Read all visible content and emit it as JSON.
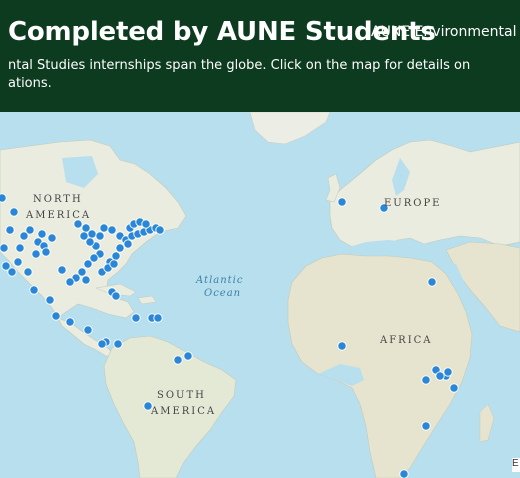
{
  "header": {
    "title": "Completed by AUNE Students",
    "subtitle": "AUNE Environmental St",
    "description_line1": "ntal Studies internships span the globe. Click on the map for details on",
    "description_line2": "ations."
  },
  "map": {
    "labels": {
      "north1": "NORTH",
      "north2": "AMERICA",
      "europe": "EUROPE",
      "africa": "AFRICA",
      "south1": "SOUTH",
      "south2": "AMERICA",
      "ocean1": "Atlantic",
      "ocean2": "Ocean"
    },
    "credit": "E",
    "colors": {
      "header_bg": "#0c3b1f",
      "ocean": "#b8dfee",
      "land": "#e9ecdf",
      "marker": "#2a86d6"
    }
  }
}
